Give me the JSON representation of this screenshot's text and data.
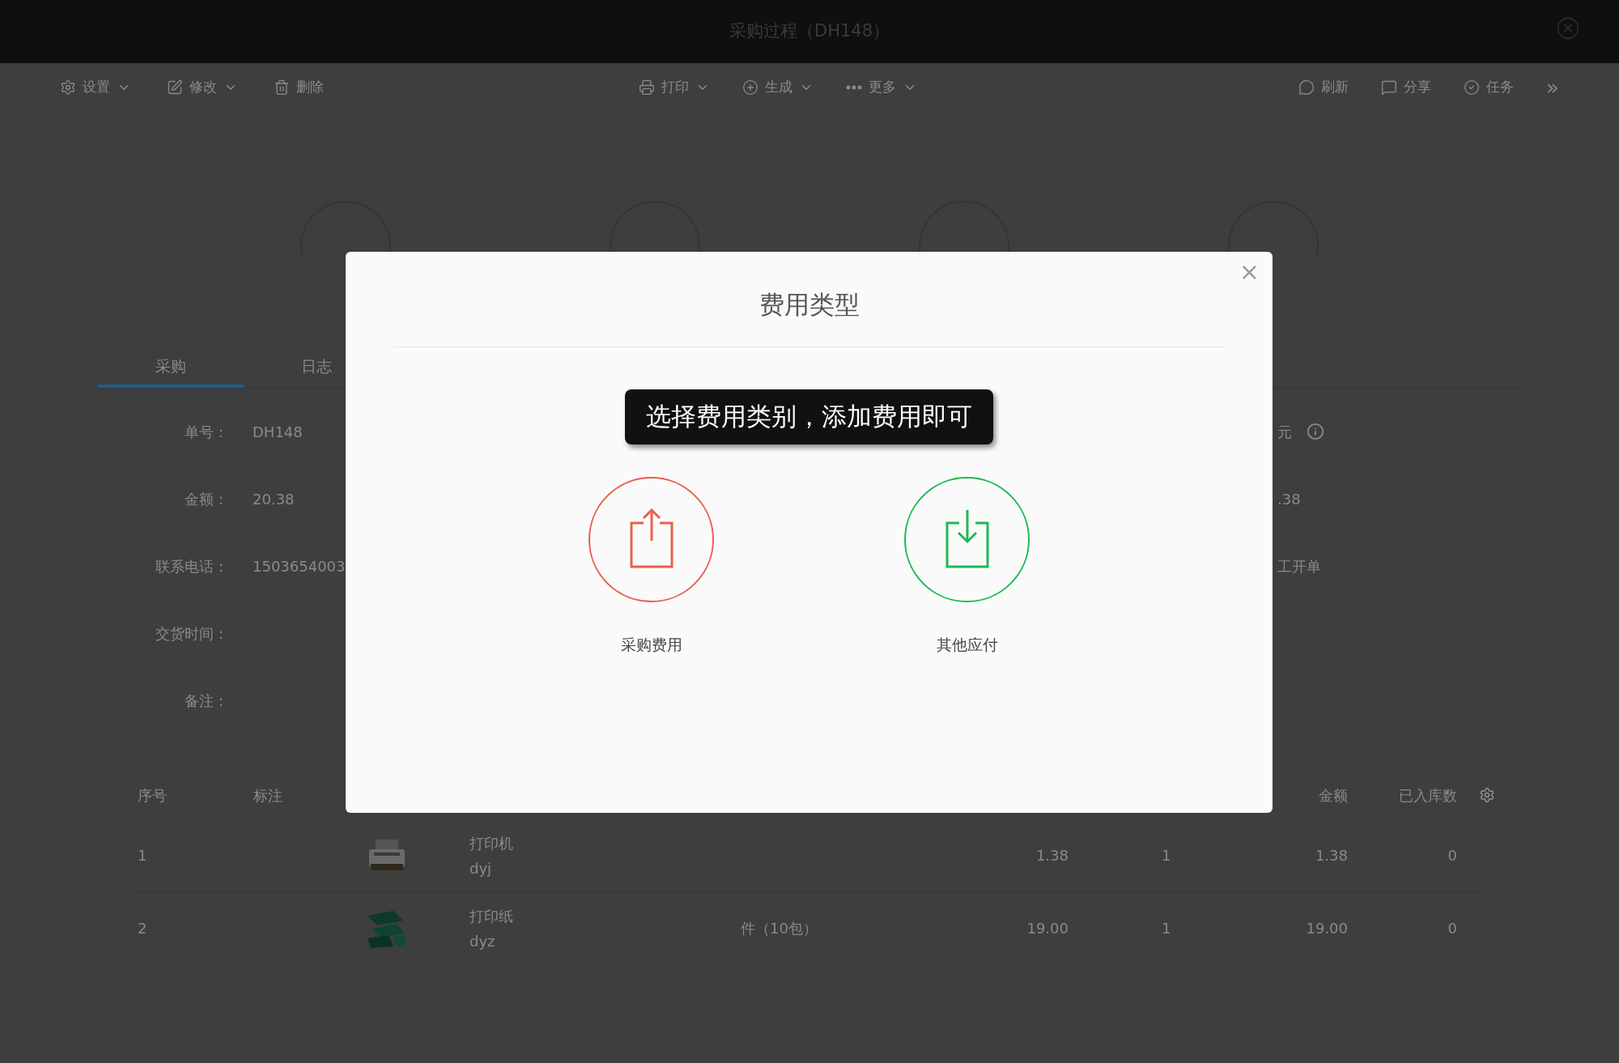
{
  "window": {
    "title": "采购过程（DH148）"
  },
  "toolbar": {
    "left": [
      {
        "label": "设置",
        "dropdown": true
      },
      {
        "label": "修改",
        "dropdown": true
      },
      {
        "label": "删除",
        "dropdown": false
      }
    ],
    "center": [
      {
        "label": "打印",
        "dropdown": true
      },
      {
        "label": "生成",
        "dropdown": true
      },
      {
        "label": "更多",
        "dropdown": true
      }
    ],
    "right": [
      {
        "label": "刷新",
        "dropdown": false
      },
      {
        "label": "分享",
        "dropdown": false
      },
      {
        "label": "任务",
        "dropdown": false
      }
    ],
    "overflow": "»"
  },
  "tabs": [
    {
      "label": "采购",
      "selected": true
    },
    {
      "label": "日志",
      "selected": false
    }
  ],
  "form": {
    "rows": [
      {
        "label": "单号：",
        "value": "DH148",
        "right": "元"
      },
      {
        "label": "金额：",
        "value": "20.38",
        "right": ".38"
      },
      {
        "label": "联系电话：",
        "value": "1503654003",
        "right": "工开单"
      },
      {
        "label": "交货时间："
      },
      {
        "label": "备注："
      }
    ]
  },
  "table": {
    "columns": [
      "序号",
      "标注",
      "金额",
      "已入库数"
    ],
    "rows": [
      {
        "no": "1",
        "name": "打印机",
        "code": "dyj",
        "unit": "",
        "price": "1.38",
        "qty": "1",
        "amount": "1.38",
        "stocked": "0",
        "kind": "printer"
      },
      {
        "no": "2",
        "name": "打印纸",
        "code": "dyz",
        "unit": "件（10包）",
        "price": "19.00",
        "qty": "1",
        "amount": "19.00",
        "stocked": "0",
        "kind": "paper"
      }
    ]
  },
  "dialog": {
    "title": "费用类型",
    "close": "×",
    "hint": "选择费用类别，添加费用即可",
    "options": [
      {
        "label": "采购费用",
        "kind": "outgoing",
        "color": "#e8604c"
      },
      {
        "label": "其他应付",
        "kind": "incoming",
        "color": "#1db954"
      }
    ]
  }
}
